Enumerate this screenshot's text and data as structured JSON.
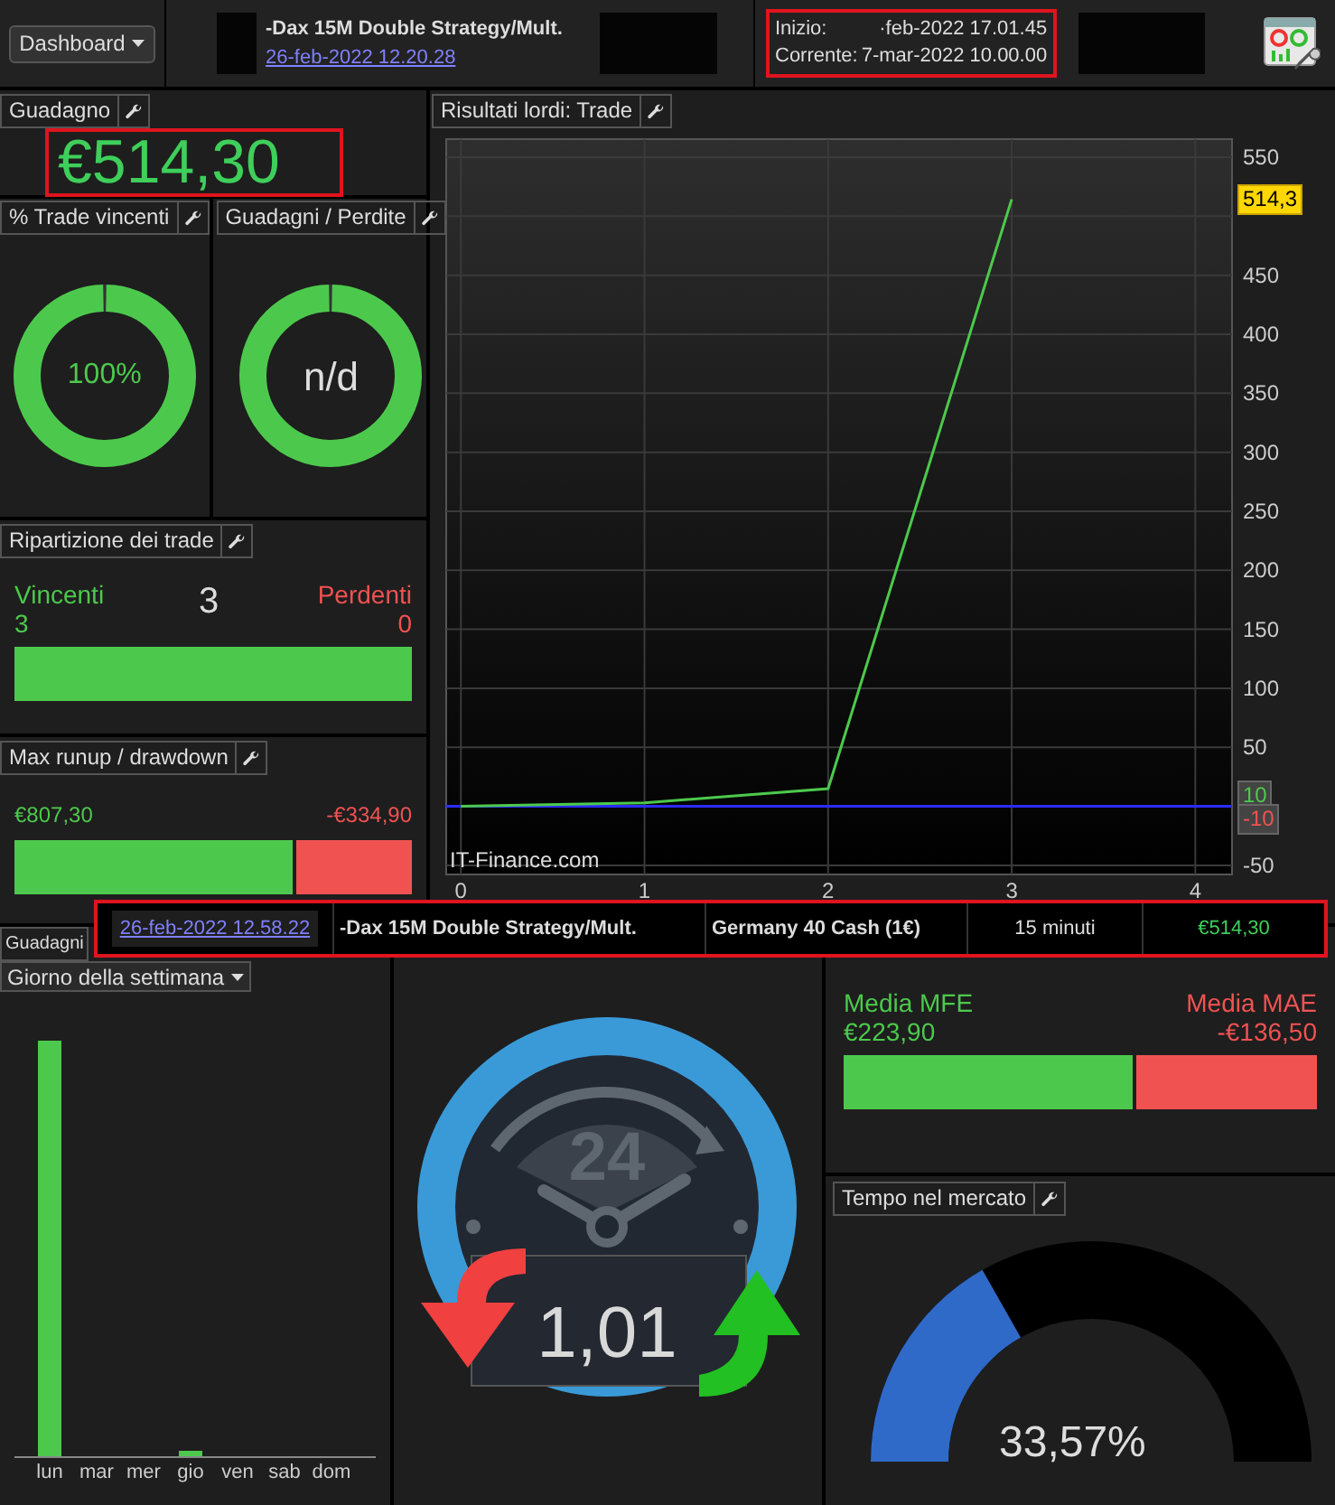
{
  "header": {
    "dashboard_button": "Dashboard",
    "strategy_title": "-Dax 15M Double Strategy/Mult.",
    "strategy_date_link": "26-feb-2022 12.20.28",
    "start_label": "Inizio:",
    "start_value": "·feb-2022 17.01.45",
    "current_label": "Corrente:",
    "current_value": "7-mar-2022 10.00.00"
  },
  "gain": {
    "title": "Guadagno",
    "value": "€514,30"
  },
  "win_rate": {
    "title": "% Trade vincenti",
    "value": "100%",
    "level": 1
  },
  "gain_loss": {
    "title": "Guadagni / Perdite",
    "value": "n/d",
    "level": 1
  },
  "trade_split": {
    "title": "Ripartizione dei trade",
    "win_label": "Vincenti",
    "win_count": "3",
    "total": "3",
    "loss_label": "Perdenti",
    "loss_count": "0",
    "level": 1
  },
  "runup": {
    "title": "Max runup / drawdown",
    "runup": "€807,30",
    "drawdown": "-€334,90",
    "level": 0.707
  },
  "chart_panel": {
    "title": "Risultati lordi: Trade",
    "watermark": "IT-Finance.com",
    "value_tags": [
      {
        "text": "514,3",
        "kind": "last"
      },
      {
        "text": "10",
        "kind": "up"
      },
      {
        "text": "-10",
        "kind": "down"
      }
    ],
    "chart_data": {
      "type": "line",
      "x": [
        0,
        1,
        2,
        3
      ],
      "series": [
        {
          "color": "#4cc94c",
          "values": [
            0,
            3,
            15,
            514.3
          ]
        }
      ],
      "xlim": [
        -0.08,
        4.2
      ],
      "ylim": [
        -57.7,
        565.3
      ],
      "xticks": [
        0,
        1,
        2,
        3,
        4
      ],
      "yticks": [
        550,
        450,
        400,
        350,
        300,
        250,
        200,
        150,
        100,
        50,
        -50
      ],
      "grid": true,
      "ref_lines": [
        {
          "axis": "y",
          "value": 0,
          "color": "#2b2bff"
        }
      ]
    }
  },
  "trade_row": {
    "date": "26-feb-2022 12.58.22",
    "strategy": "-Dax 15M Double Strategy/Mult.",
    "instrument": "Germany 40 Cash (1€)",
    "timeframe": "15 minuti",
    "result": "€514,30"
  },
  "weekday_panel": {
    "title": "Guadagni",
    "selector": "Giorno della settimana",
    "days": [
      "lun",
      "mar",
      "mer",
      "gio",
      "ven",
      "sab",
      "dom"
    ]
  },
  "duration": {
    "clock_label": "24",
    "value": "1,01"
  },
  "mfe_mae": {
    "mfe_label": "Media MFE",
    "mfe_value": "€223,90",
    "mae_label": "Media MAE",
    "mae_value": "-€136,50",
    "level": 0.62
  },
  "time_in_market": {
    "title": "Tempo nel mercato",
    "value": "33,57%",
    "level": 0.3357
  }
}
